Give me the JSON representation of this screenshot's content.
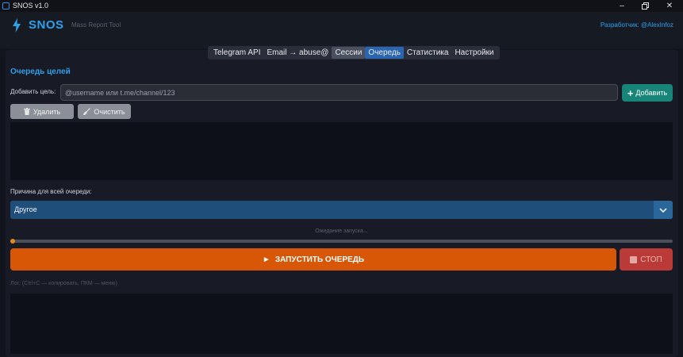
{
  "window": {
    "title": "SNOS v1.0",
    "controls": [
      "minimize",
      "maximize",
      "close"
    ]
  },
  "header": {
    "brand": "SNOS",
    "subtitle": "Mass Report Tool",
    "developer": "Разработчик: @AlexInfoz",
    "accent_color": "#2fa0ea"
  },
  "tabs": [
    {
      "label": "Telegram API",
      "state": "normal"
    },
    {
      "label": "Email → abuse@",
      "state": "normal"
    },
    {
      "label": "Сессии",
      "state": "highlighted"
    },
    {
      "label": "Очередь",
      "state": "active"
    },
    {
      "label": "Статистика",
      "state": "normal"
    },
    {
      "label": "Настройки",
      "state": "normal"
    }
  ],
  "queue": {
    "section_title": "Очередь целей",
    "add_label": "Добавить цель:",
    "input_value": "",
    "input_placeholder": "@username или t.me/channel/123",
    "add_button": "Добавить",
    "delete_button": "Удалить",
    "clear_button": "Очистить",
    "items": []
  },
  "reason": {
    "label": "Причина для всей очереди:",
    "selected": "Другое"
  },
  "run": {
    "status": "Ожидание запуска...",
    "progress": 0,
    "start_button": "ЗАПУСТИТЬ ОЧЕРЕДЬ",
    "stop_button": "СТОП",
    "start_color": "#d85706",
    "stop_color": "#b93a36"
  },
  "log": {
    "label": "Лог: (Ctrl+C — копировать, ПКМ — меню)",
    "lines": []
  }
}
